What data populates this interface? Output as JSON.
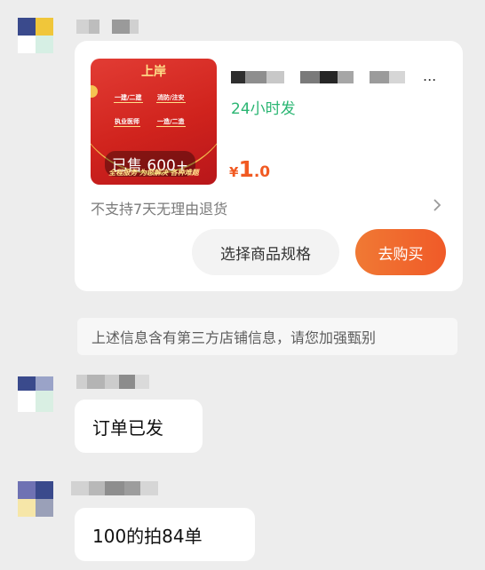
{
  "product_card": {
    "image": {
      "banner_title": "上岸",
      "tags": [
        "一建/二建",
        "消防/注安",
        "执业医师",
        "一造/二造"
      ],
      "sold_label": "已售 600+",
      "bottom_text": "全程服务 为您解决 各种难题"
    },
    "title_ellipsis": "...",
    "shipping": "24小时发",
    "price": {
      "currency": "¥",
      "integer": "1",
      "decimal": ".0"
    },
    "return_policy": "不支持7天无理由退货",
    "spec_button": "选择商品规格",
    "buy_button": "去购买"
  },
  "notice": "上述信息含有第三方店铺信息，请您加强甄别",
  "messages": [
    {
      "text": "订单已发"
    },
    {
      "text": "100的拍84单"
    }
  ],
  "colors": {
    "accent_orange": "#f05a28",
    "shipping_green": "#2bb673",
    "chat_background": "#ededed"
  },
  "icons": {
    "policy_chevron": "chevron-right-icon"
  }
}
